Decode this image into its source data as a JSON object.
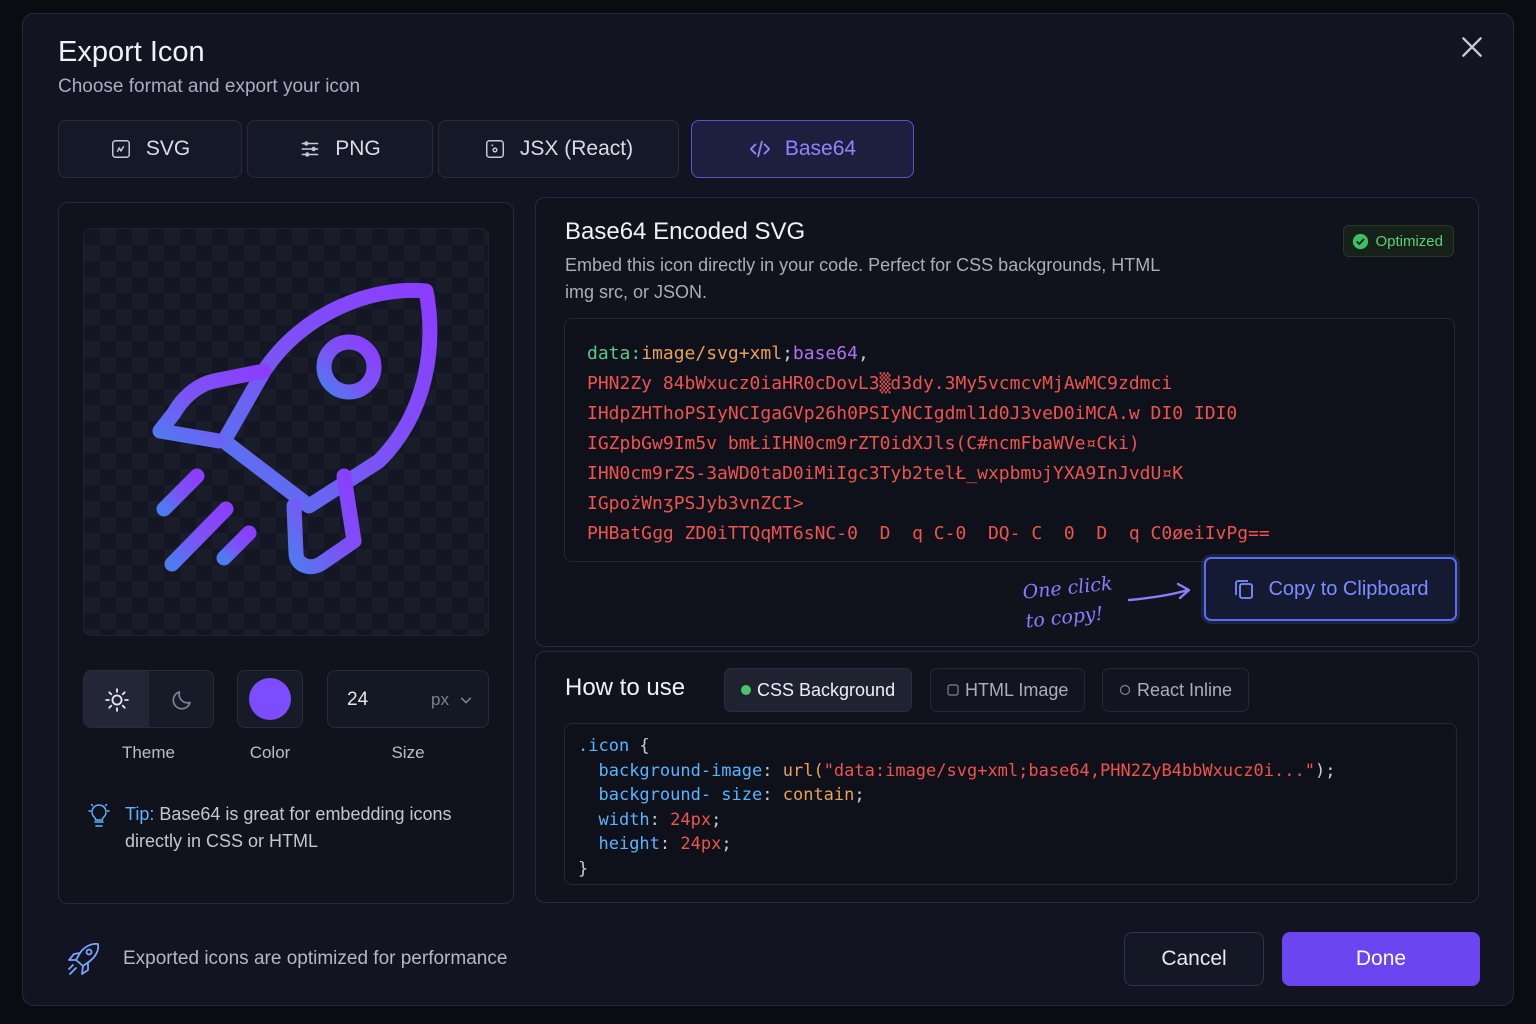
{
  "dialog": {
    "title": "Export Icon",
    "subtitle": "Choose format and export your icon"
  },
  "tabs": [
    {
      "label": "SVG",
      "icon": "svg-file-icon"
    },
    {
      "label": "PNG",
      "icon": "png-image-icon"
    },
    {
      "label": "JSX (React)",
      "icon": "jsx-file-icon"
    },
    {
      "label": "Base64",
      "icon": "code-icon",
      "active": true
    }
  ],
  "preview": {
    "icon": "rocket-icon",
    "theme": {
      "label": "Theme",
      "selected": "light"
    },
    "color": {
      "label": "Color",
      "value": "#7c4dff"
    },
    "size": {
      "label": "Size",
      "value": "24",
      "unit": "px"
    },
    "tip": {
      "key": "Tip:",
      "text": " Base64 is great for embedding icons directly in CSS or HTML"
    }
  },
  "encoded": {
    "title": "Base64 Encoded SVG",
    "description": "Embed this icon directly in your code. Perfect for CSS backgrounds, HTML img src, or JSON.",
    "badge": "Optimized",
    "prefix_scheme": "data:",
    "prefix_mime": "image/svg+xml",
    "prefix_sep": ";",
    "prefix_kw": "base64",
    "prefix_end": ",",
    "lines": [
      "PHN2Zy 84bWxucz0iaHR0cDovL3▒d3dy.3My5vcmcvMjAwMC9zdmci",
      "IHdpZHThoPSIyNCIgaGVp26h0PSIyNCIgdml1d0J3veD0iMCA.w DI0 IDI0",
      "IGZpbGw9Im5v bmŁiIHN0cm9rZT0idXJls(C#ncmFbaWVe¤Cki)",
      "IHN0cm9rZS-3aWD0taD0iMiIgc3Tyb2telŁ_wxpbmʋjYXA9InJvdU¤K",
      "IGpożWnʒPSJyb3vnZCI>",
      "PHBatGɡg ZD0iTTQqMT6sNC-0  D  q C-0  DQ- C  0  D  q C0øeiIvPg=="
    ],
    "annotation": "One click to copy!",
    "copy_label": "Copy to Clipboard"
  },
  "how_to_use": {
    "title": "How to use",
    "tabs": [
      {
        "label": "CSS Background",
        "active": true
      },
      {
        "label": "HTML Image"
      },
      {
        "label": "React Inline"
      }
    ],
    "code": {
      "selector": ".icon",
      "open": " {",
      "close": "}",
      "rules": [
        {
          "prop": "background-image",
          "value_fn": "url(",
          "value_str": "\"data:image/svg+xml;base64,PHN2ZyB4bbWxucz0i...\"",
          "value_end": ");"
        },
        {
          "prop": "background- size",
          "value_fn": "",
          "value_str": "",
          "value_kw": "contain",
          "value_end": ";"
        },
        {
          "prop": "width",
          "value_num": "24px",
          "value_end": ";"
        },
        {
          "prop": "height",
          "value_num": "24px",
          "value_end": ";"
        }
      ]
    }
  },
  "footer": {
    "text": "Exported icons are optimized for performance",
    "cancel": "Cancel",
    "done": "Done"
  },
  "colors": {
    "accent": "#6a45f0",
    "accent_text": "#8f86ff",
    "success": "#58d07a",
    "tip": "#5db3ff"
  }
}
